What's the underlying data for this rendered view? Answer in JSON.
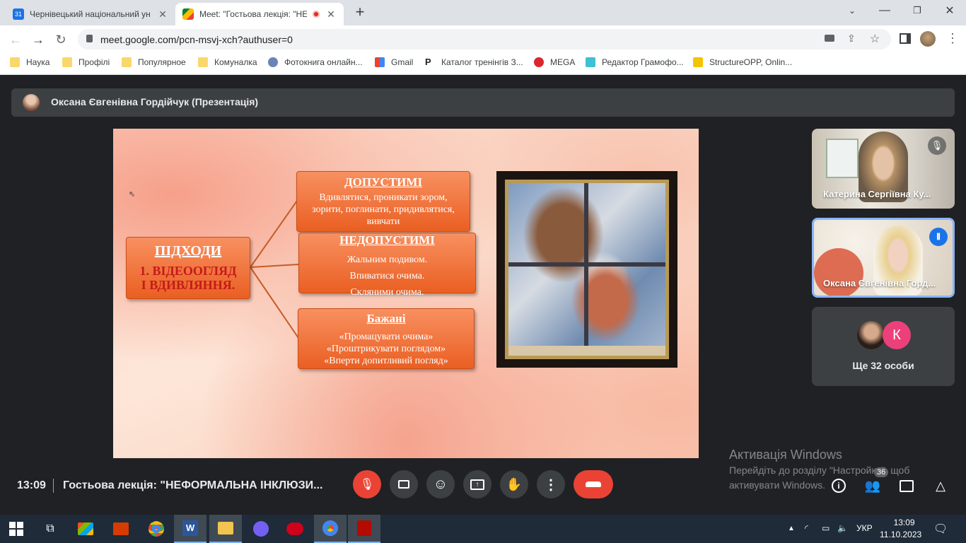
{
  "browser": {
    "tabs": [
      {
        "title": "Чернівецький національний ун",
        "active": false
      },
      {
        "title": "Meet: \"Гостьова лекція: \"НЕ",
        "active": true
      }
    ],
    "new_tab": "+",
    "url": "meet.google.com/pcn-msvj-xch?authuser=0",
    "bookmarks": [
      "Наука",
      "Профілі",
      "Популярное",
      "Комуналка",
      "Фотокнига онлайн...",
      "Gmail",
      "Каталог тренінгів З...",
      "MEGA",
      "Редактор Грамофо...",
      "StructureOPP, Onlin..."
    ]
  },
  "meet": {
    "presenter_banner": "Оксана Євгенівна Гордійчук (Презентація)",
    "slide": {
      "main_title": "ПІДХОДИ",
      "main_sub_1": "1. ВІДЕООГЛЯД",
      "main_sub_2": "І ВДИВЛЯННЯ.",
      "box1_title": "ДОПУСТИМІ",
      "box1_lines": [
        "Вдивлятися, проникати зором,",
        "зорити, поглинати, придивлятися,",
        "вивчати"
      ],
      "box2_title": "НЕДОПУСТИМІ",
      "box2_lines": [
        "Жальним подивом.",
        "Впиватися очима.",
        "Скляними очима."
      ],
      "box3_title": "Бажані",
      "box3_lines": [
        "«Промацувати очима»",
        "«Проштрикувати поглядом»",
        "«Вперти допитливий погляд»"
      ]
    },
    "participants": [
      {
        "name": "Катерина Сергіївна Ку...",
        "muted": true
      },
      {
        "name": "Оксана Євгенівна Горд...",
        "speaking": true
      }
    ],
    "more_people": {
      "initial": "К",
      "label": "Ще 32 особи"
    },
    "time": "13:09",
    "meeting_title": "Гостьова лекція: \"НЕФОРМАЛЬНА ІНКЛЮЗИ...",
    "people_count": "36",
    "watermark_title": "Активація Windows",
    "watermark_line1": "Перейдіть до розділу \"Настройки\", щоб",
    "watermark_line2": "активувати Windows."
  },
  "taskbar": {
    "lang": "УКР",
    "time": "13:09",
    "date": "11.10.2023"
  },
  "colors": {
    "accent": "#1a73e8",
    "end_call": "#ea4335",
    "orange_box": "#ef6b2e",
    "bg": "#202124"
  }
}
